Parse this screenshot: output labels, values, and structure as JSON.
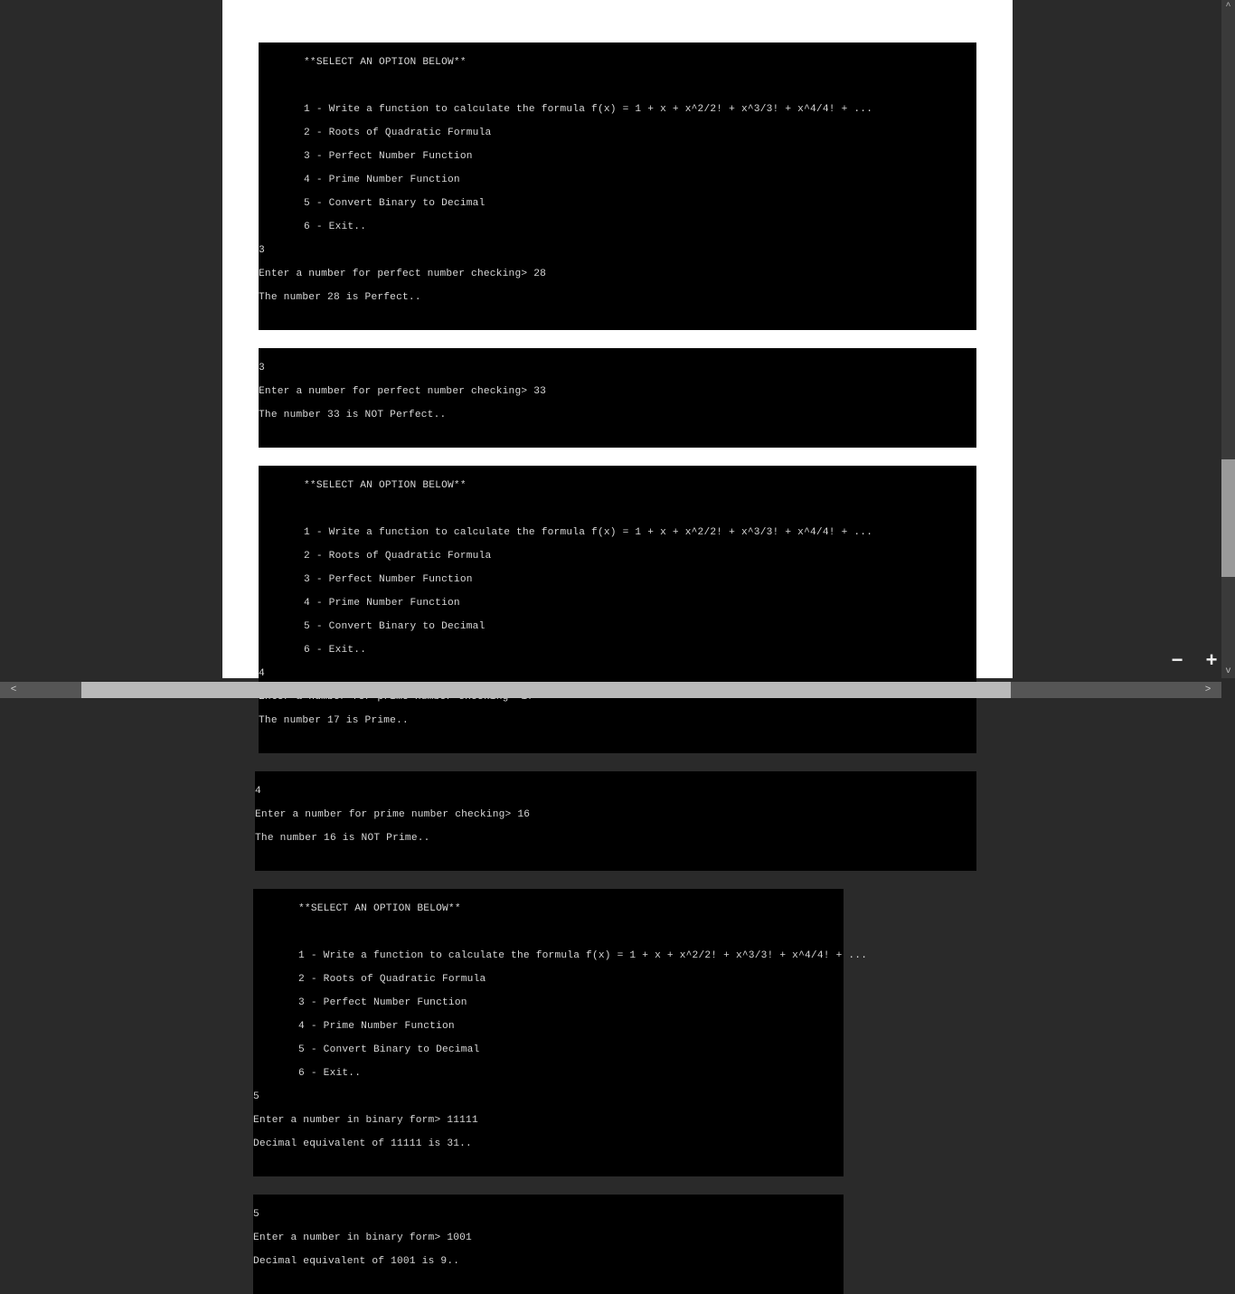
{
  "menu": {
    "title": "**SELECT AN OPTION BELOW**",
    "opt1": "1 - Write a function to calculate the formula f(x) = 1 + x + x^2/2! + x^3/3! + x^4/4! + ...",
    "opt2": "2 - Roots of Quadratic Formula",
    "opt3": "3 - Perfect Number Function",
    "opt4": "4 - Prime Number Function",
    "opt5": "5 - Convert Binary to Decimal",
    "opt6": "6 - Exit.."
  },
  "block1": {
    "choice": "3",
    "prompt": "Enter a number for perfect number checking> 28",
    "result": "The number 28 is Perfect.."
  },
  "block2": {
    "choice": "3",
    "prompt": "Enter a number for perfect number checking> 33",
    "result": "The number 33 is NOT Perfect.."
  },
  "block3": {
    "choice": "4",
    "prompt": "Enter a number for prime number checking> 17",
    "result": "The number 17 is Prime.."
  },
  "block4": {
    "choice": "4",
    "prompt": "Enter a number for prime number checking> 16",
    "result": "The number 16 is NOT Prime.."
  },
  "block5": {
    "choice": "5",
    "prompt": "Enter a number in binary form> 11111",
    "result": "Decimal equivalent of 11111 is 31.."
  },
  "block6": {
    "choice": "5",
    "prompt": "Enter a number in binary form> 1001",
    "result": "Decimal equivalent of 1001 is 9.."
  },
  "zoom": {
    "minus": "−",
    "plus": "+"
  },
  "hscroll": {
    "left": "<",
    "right": ">"
  },
  "vscroll": {
    "up": "^",
    "down": "v"
  }
}
